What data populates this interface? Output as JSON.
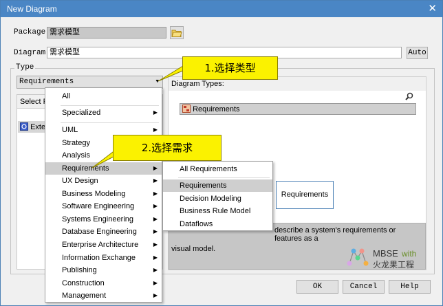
{
  "window": {
    "title": "New Diagram",
    "close_glyph": "✕"
  },
  "package": {
    "label": "Package",
    "value": "需求模型",
    "folder_icon": "folder-icon"
  },
  "diagram": {
    "label": "Diagram",
    "value": "需求模型",
    "auto_label": "Auto"
  },
  "type_group": {
    "label": "Type"
  },
  "type_combo": {
    "value": "Requirements",
    "arrow": "▾"
  },
  "select_from": {
    "label": "Select Fr",
    "item": "Exten"
  },
  "diagram_types": {
    "label": "Diagram Types:",
    "search_icon": "search-icon",
    "selected": "Requirements"
  },
  "preview": {
    "label": "Requirements"
  },
  "description": {
    "text": "describe a system's requirements or features as a",
    "text2": "visual model."
  },
  "logo": {
    "text1": "MBSE",
    "text2": "with",
    "text3": "火龙果工程"
  },
  "callouts": {
    "first": "1.选择类型",
    "second": "2.选择需求"
  },
  "menu1": {
    "items": [
      {
        "label": "All",
        "arrow": ""
      },
      {
        "label": "Specialized",
        "arrow": "▶"
      },
      {
        "label": "UML",
        "arrow": "▶"
      },
      {
        "label": "Strategy",
        "arrow": "▶"
      },
      {
        "label": "Analysis",
        "arrow": "▶"
      },
      {
        "label": "Requirements",
        "arrow": "▶"
      },
      {
        "label": "UX Design",
        "arrow": "▶"
      },
      {
        "label": "Business Modeling",
        "arrow": "▶"
      },
      {
        "label": "Software Engineering",
        "arrow": "▶"
      },
      {
        "label": "Systems Engineering",
        "arrow": "▶"
      },
      {
        "label": "Database Engineering",
        "arrow": "▶"
      },
      {
        "label": "Enterprise Architecture",
        "arrow": "▶"
      },
      {
        "label": "Information Exchange",
        "arrow": "▶"
      },
      {
        "label": "Publishing",
        "arrow": "▶"
      },
      {
        "label": "Construction",
        "arrow": "▶"
      },
      {
        "label": "Management",
        "arrow": "▶"
      }
    ]
  },
  "menu2": {
    "items": [
      {
        "label": "All Requirements"
      },
      {
        "label": "Requirements"
      },
      {
        "label": "Decision Modeling"
      },
      {
        "label": "Business Rule Model"
      },
      {
        "label": "Dataflows"
      }
    ]
  },
  "buttons": {
    "ok": "OK",
    "cancel": "Cancel",
    "help": "Help"
  }
}
